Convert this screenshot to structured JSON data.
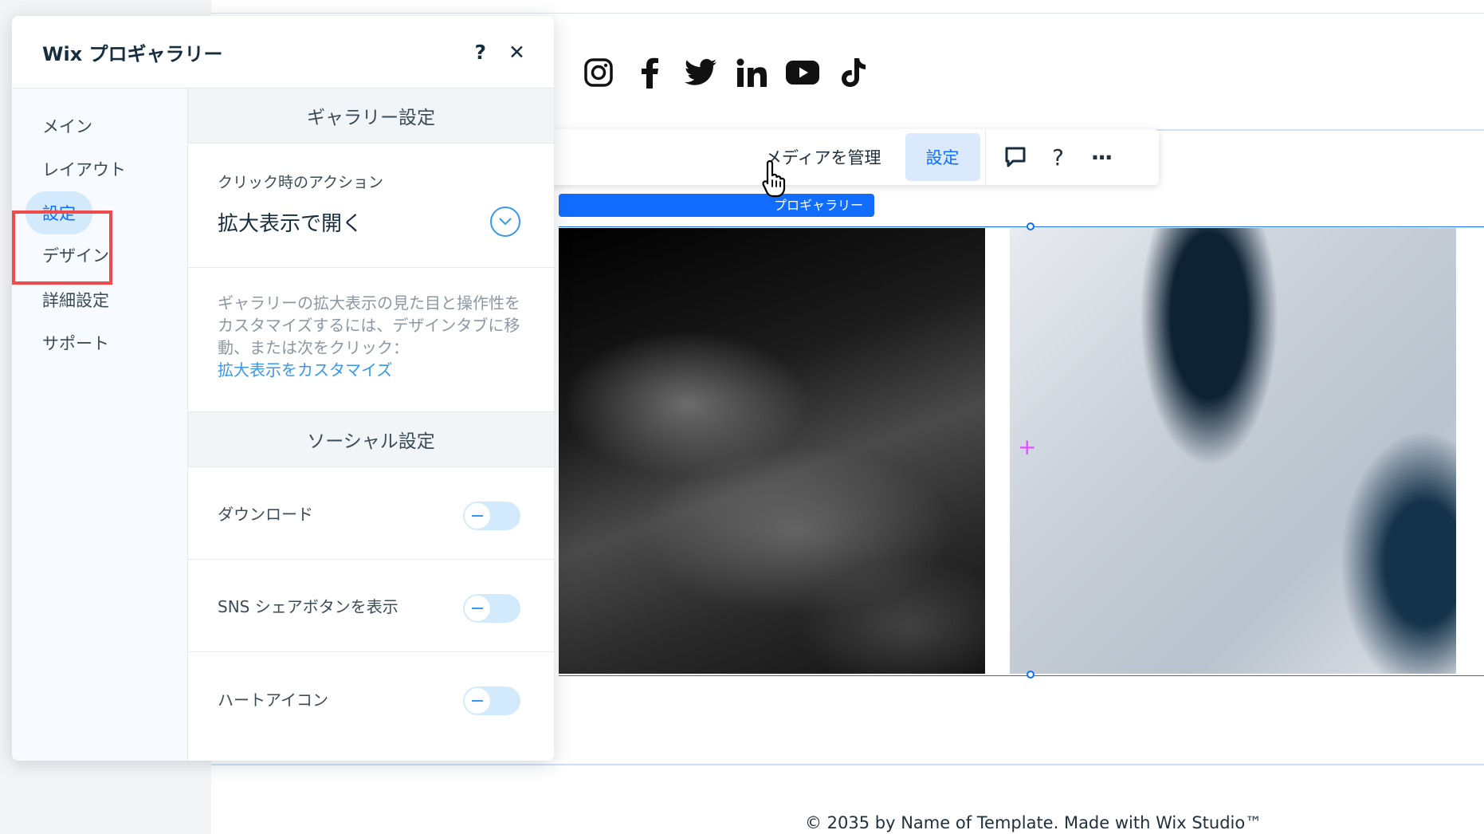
{
  "panel": {
    "title": "Wix プロギャラリー",
    "help_icon": "?",
    "close_icon": "✕"
  },
  "nav": {
    "items": [
      {
        "label": "メイン"
      },
      {
        "label": "レイアウト"
      },
      {
        "label": "設定",
        "active": true
      },
      {
        "label": "デザイン"
      },
      {
        "label": "詳細設定"
      },
      {
        "label": "サポート"
      }
    ]
  },
  "gallery_settings": {
    "section_title": "ギャラリー設定",
    "click_action_label": "クリック時のアクション",
    "click_action_value": "拡大表示で開く",
    "info_text": "ギャラリーの拡大表示の見た目と操作性をカスタマイズするには、デザインタブに移動、または次をクリック：",
    "info_link": "拡大表示をカスタマイズ"
  },
  "social_settings": {
    "section_title": "ソーシャル設定",
    "toggles": [
      {
        "label": "ダウンロード",
        "on": false
      },
      {
        "label": "SNS シェアボタンを表示",
        "on": false
      },
      {
        "label": "ハートアイコン",
        "on": false
      }
    ]
  },
  "toolbar": {
    "manage_media": "メディアを管理",
    "settings": "設定",
    "comment_icon": "comment-icon",
    "help": "?",
    "more": "···"
  },
  "selection_tag": "プロギャラリー",
  "social_icons": [
    "instagram-icon",
    "facebook-icon",
    "twitter-icon",
    "linkedin-icon",
    "youtube-icon",
    "tiktok-icon"
  ],
  "footer": {
    "text": "© 2035 by Name of Template. Made with Wix Studio™"
  },
  "colors": {
    "accent": "#116dff",
    "link": "#3899ec",
    "highlight": "#ef4b4b",
    "toggle_bg": "#d3eafd"
  }
}
